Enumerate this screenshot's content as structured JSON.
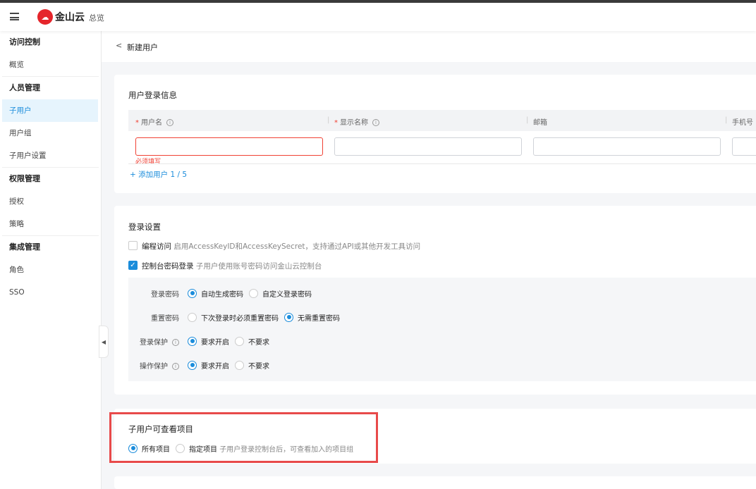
{
  "header": {
    "logo_text": "金山云",
    "overview": "总览"
  },
  "sidebar": {
    "groups": [
      {
        "title": "访问控制",
        "items": [
          "概览"
        ]
      },
      {
        "title": "人员管理",
        "items": [
          "子用户",
          "用户组",
          "子用户设置"
        ]
      },
      {
        "title": "权限管理",
        "items": [
          "授权",
          "策略"
        ]
      },
      {
        "title": "集成管理",
        "items": [
          "角色",
          "SSO"
        ]
      }
    ],
    "active": "子用户"
  },
  "page": {
    "back": "<",
    "title": "新建用户"
  },
  "login_info": {
    "title": "用户登录信息",
    "columns": [
      {
        "label": "用户名",
        "required": "*"
      },
      {
        "label": "显示名称",
        "required": "*"
      },
      {
        "label": "邮箱"
      },
      {
        "label": "手机号"
      }
    ],
    "error": "必须填写",
    "add_user": "+ 添加用户 1 / 5"
  },
  "login_settings": {
    "title": "登录设置",
    "programmatic": {
      "label": "编程访问",
      "desc": "启用AccessKeyID和AccessKeySecret，支持通过API或其他开发工具访问",
      "checked": false
    },
    "console": {
      "label": "控制台密码登录",
      "desc": "子用户使用账号密码访问金山云控制台",
      "checked": true
    },
    "fields": [
      {
        "label": "登录密码",
        "options": [
          "自动生成密码",
          "自定义登录密码"
        ],
        "selected": 0
      },
      {
        "label": "重置密码",
        "options": [
          "下次登录时必须重置密码",
          "无需重置密码"
        ],
        "selected": 1
      },
      {
        "label": "登录保护",
        "options": [
          "要求开启",
          "不要求"
        ],
        "selected": 0
      },
      {
        "label": "操作保护",
        "options": [
          "要求开启",
          "不要求"
        ],
        "selected": 0
      }
    ]
  },
  "projects": {
    "title": "子用户可查看项目",
    "options": [
      "所有项目",
      "指定项目"
    ],
    "selected": 0,
    "desc": "子用户登录控制台后，可查看加入的项目组"
  }
}
